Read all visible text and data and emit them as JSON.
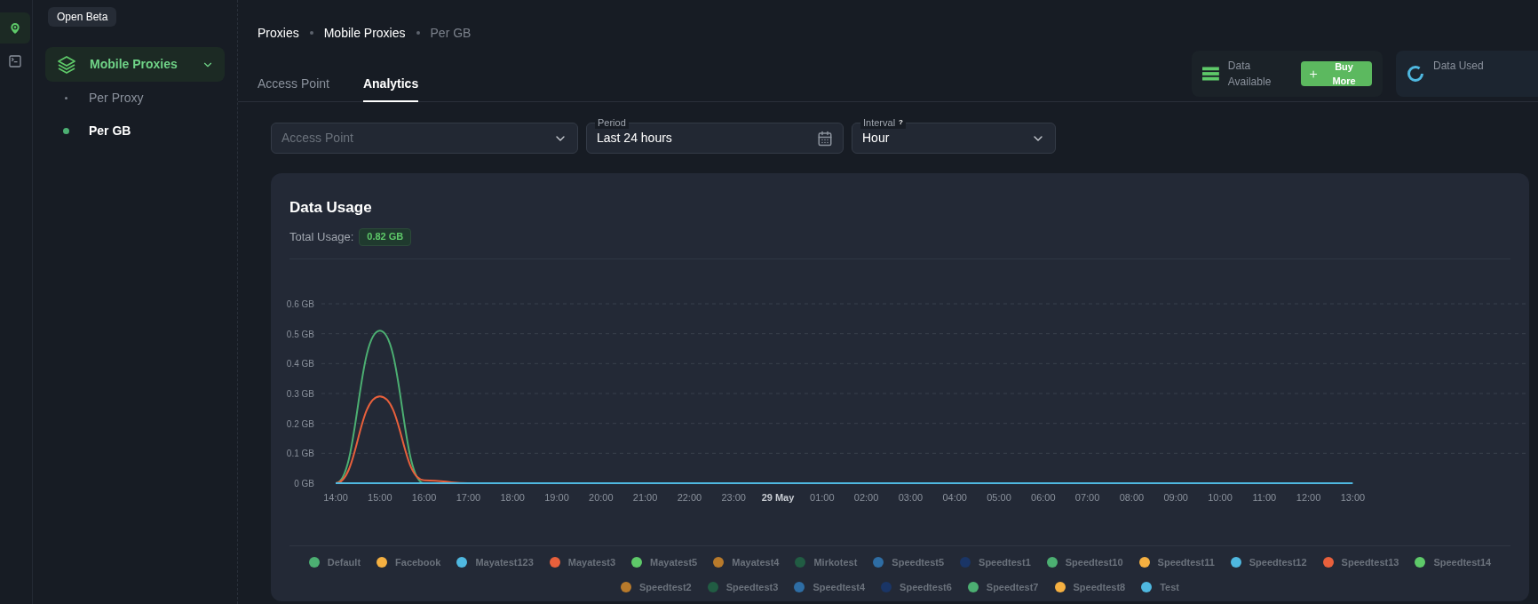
{
  "rail": [
    {
      "kind": "pin",
      "selected": true
    },
    {
      "kind": "terminal",
      "selected": false
    }
  ],
  "tooltip": "Open Beta",
  "sidebar": {
    "items": [
      {
        "label": "Mobile Proxies",
        "expanded": true,
        "selected": true,
        "children": [
          {
            "label": "Per Proxy",
            "selected": false
          },
          {
            "label": "Per GB",
            "selected": true
          }
        ]
      }
    ]
  },
  "breadcrumb": [
    "Proxies",
    "Mobile Proxies",
    "Per GB"
  ],
  "tabs": [
    {
      "label": "Access Point",
      "selected": false
    },
    {
      "label": "Analytics",
      "selected": true
    }
  ],
  "stats": [
    {
      "kind": "available",
      "label": "Data Available",
      "button": "Buy More"
    },
    {
      "kind": "used",
      "label": "Data Used"
    }
  ],
  "filters": [
    {
      "kind": "select",
      "placeholder": "Access Point"
    },
    {
      "kind": "date",
      "label": "Period",
      "value": "Last 24 hours"
    },
    {
      "kind": "select",
      "label": "Interval",
      "help": "?",
      "value": "Hour"
    }
  ],
  "usage": {
    "title": "Data Usage",
    "total_label": "Total Usage:",
    "total": "0.82 GB",
    "chart_data": {
      "type": "line",
      "categories": [
        "14:00",
        "15:00",
        "16:00",
        "17:00",
        "18:00",
        "19:00",
        "20:00",
        "21:00",
        "22:00",
        "23:00",
        "29 May",
        "01:00",
        "02:00",
        "03:00",
        "04:00",
        "05:00",
        "06:00",
        "07:00",
        "08:00",
        "09:00",
        "10:00",
        "11:00",
        "12:00",
        "13:00"
      ],
      "series": [
        {
          "color": "#4caf72",
          "values": [
            0,
            0.51,
            0,
            null,
            null,
            null,
            null,
            null,
            null,
            null,
            null,
            null,
            null,
            null,
            null,
            null,
            null,
            null,
            null,
            null,
            null,
            null,
            null,
            null
          ]
        },
        {
          "color": "#e8603c",
          "values": [
            0,
            0.29,
            0.01,
            0,
            null,
            null,
            null,
            null,
            null,
            null,
            null,
            null,
            null,
            null,
            null,
            null,
            null,
            null,
            null,
            null,
            null,
            null,
            null,
            null
          ]
        },
        {
          "color": "#4fb8e0",
          "values": [
            0,
            0,
            0,
            0,
            0,
            0,
            0,
            0,
            0,
            0,
            0,
            0,
            0,
            0,
            0,
            0,
            0,
            0,
            0,
            0,
            0,
            0,
            0,
            0
          ]
        }
      ],
      "ylim": [
        0,
        0.6
      ],
      "grid": true,
      "yticks": [
        {
          "value": 0,
          "label": "0 GB"
        },
        {
          "value": 0.1,
          "label": "0.1 GB"
        },
        {
          "value": 0.2,
          "label": "0.2 GB"
        },
        {
          "value": 0.3,
          "label": "0.3 GB"
        },
        {
          "value": 0.4,
          "label": "0.4 GB"
        },
        {
          "value": 0.5,
          "label": "0.5 GB"
        },
        {
          "value": 0.6,
          "label": "0.6 GB"
        }
      ]
    },
    "legend": [
      {
        "name": "Default",
        "color": "#4caf72"
      },
      {
        "name": "Facebook",
        "color": "#f5b041"
      },
      {
        "name": "Mayatest123",
        "color": "#4fb8e0"
      },
      {
        "name": "Mayatest3",
        "color": "#e8603c"
      },
      {
        "name": "Mayatest5",
        "color": "#5ec969"
      },
      {
        "name": "Mayatest4",
        "color": "#b87a2b"
      },
      {
        "name": "Mirkotest",
        "color": "#215c43"
      },
      {
        "name": "Speedtest5",
        "color": "#2e6da4"
      },
      {
        "name": "Speedtest1",
        "color": "#1a3566"
      },
      {
        "name": "Speedtest10",
        "color": "#4caf72"
      },
      {
        "name": "Speedtest11",
        "color": "#f5b041"
      },
      {
        "name": "Speedtest12",
        "color": "#4fb8e0"
      },
      {
        "name": "Speedtest13",
        "color": "#e8603c"
      },
      {
        "name": "Speedtest14",
        "color": "#5ec969"
      },
      {
        "name": "Speedtest2",
        "color": "#b87a2b"
      },
      {
        "name": "Speedtest3",
        "color": "#215c43"
      },
      {
        "name": "Speedtest4",
        "color": "#2e6da4"
      },
      {
        "name": "Speedtest6",
        "color": "#1a3566"
      },
      {
        "name": "Speedtest7",
        "color": "#4caf72"
      },
      {
        "name": "Speedtest8",
        "color": "#f5b041"
      },
      {
        "name": "Test",
        "color": "#4fb8e0"
      }
    ]
  }
}
